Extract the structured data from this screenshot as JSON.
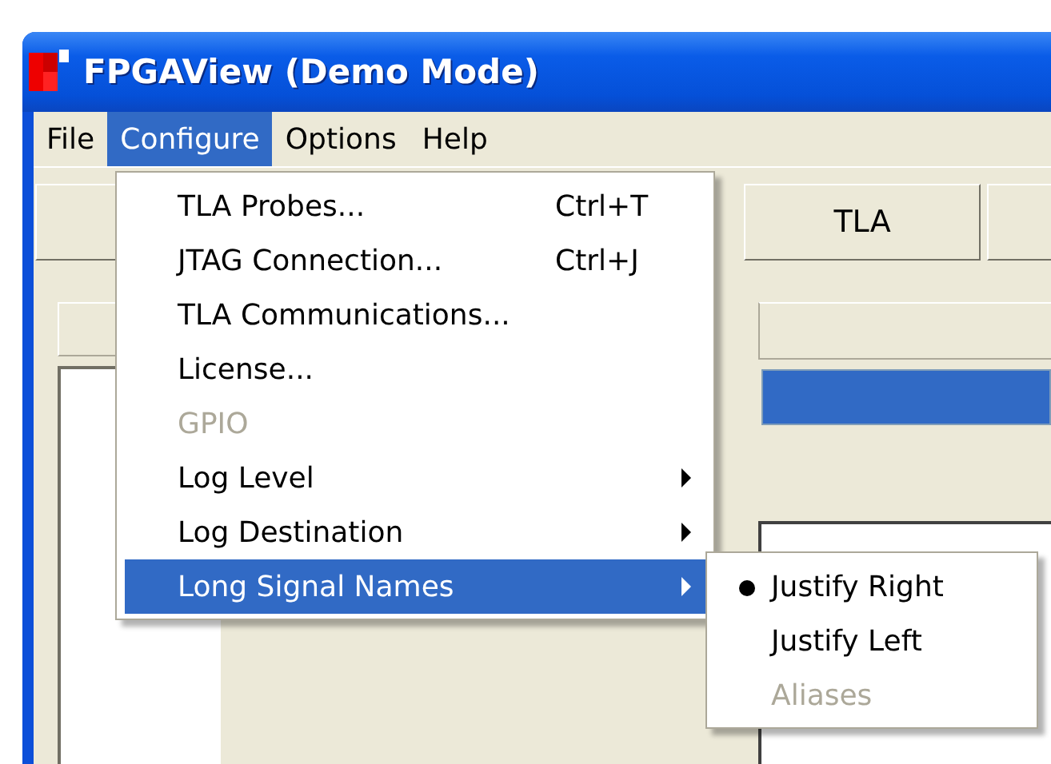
{
  "window": {
    "title": "FPGAView (Demo Mode)"
  },
  "menu_bar": [
    {
      "label": "File",
      "selected": false
    },
    {
      "label": "Configure",
      "selected": true
    },
    {
      "label": "Options",
      "selected": false
    },
    {
      "label": "Help",
      "selected": false
    }
  ],
  "toolbar_buttons": [
    {
      "label": "TLA"
    }
  ],
  "configure_menu": [
    {
      "label": "TLA Probes...",
      "shortcut": "Ctrl+T",
      "disabled": false,
      "submenu": false,
      "selected": false
    },
    {
      "label": "JTAG Connection...",
      "shortcut": "Ctrl+J",
      "disabled": false,
      "submenu": false,
      "selected": false
    },
    {
      "label": "TLA Communications...",
      "disabled": false,
      "submenu": false,
      "selected": false
    },
    {
      "label": "License...",
      "disabled": false,
      "submenu": false,
      "selected": false
    },
    {
      "label": "GPIO",
      "disabled": true,
      "submenu": false,
      "selected": false
    },
    {
      "label": "Log Level",
      "disabled": false,
      "submenu": true,
      "selected": false
    },
    {
      "label": "Log Destination",
      "disabled": false,
      "submenu": true,
      "selected": false
    },
    {
      "label": "Long Signal Names",
      "disabled": false,
      "submenu": true,
      "selected": true
    }
  ],
  "long_signal_names_submenu": [
    {
      "label": "Justify Right",
      "checked": true,
      "disabled": false
    },
    {
      "label": "Justify Left",
      "checked": false,
      "disabled": false
    },
    {
      "label": "Aliases",
      "checked": false,
      "disabled": true
    }
  ]
}
